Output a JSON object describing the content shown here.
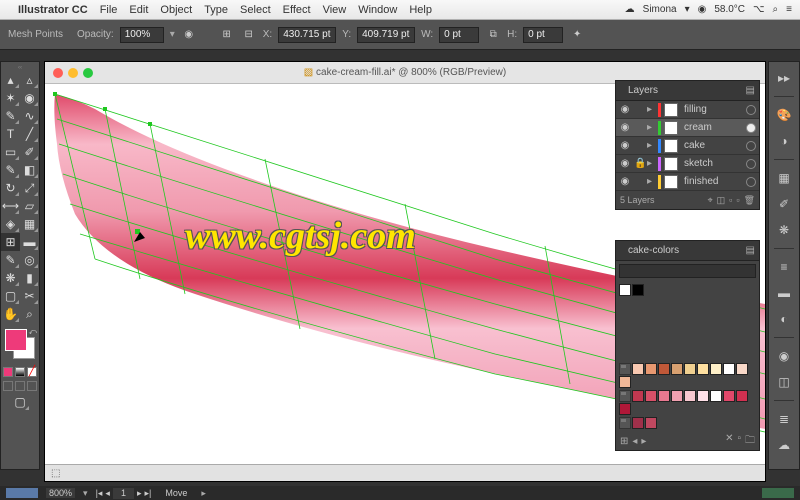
{
  "menubar": {
    "app": "Illustrator CC",
    "items": [
      "File",
      "Edit",
      "Object",
      "Type",
      "Select",
      "Effect",
      "View",
      "Window",
      "Help"
    ],
    "user": "Simona",
    "temp": "58.0°C",
    "search_icon": "⌕"
  },
  "control": {
    "label": "Mesh Points",
    "opacity_label": "Opacity:",
    "opacity_value": "100%",
    "x_label": "X:",
    "x_value": "430.715 pt",
    "y_label": "Y:",
    "y_value": "409.719 pt",
    "w_label": "W:",
    "w_value": "0 pt",
    "h_label": "H:",
    "h_value": "0 pt"
  },
  "document": {
    "title": "cake-cream-fill.ai* @ 800% (RGB/Preview)",
    "zoom": "800%",
    "mode": "Move"
  },
  "watermark": "www.cgtsj.com",
  "layers": {
    "tab": "Layers",
    "items": [
      {
        "name": "filling",
        "color": "#ff3333",
        "locked": false,
        "selected": false
      },
      {
        "name": "cream",
        "color": "#33cc33",
        "locked": false,
        "selected": true
      },
      {
        "name": "cake",
        "color": "#3388ff",
        "locked": false,
        "selected": false
      },
      {
        "name": "sketch",
        "color": "#cc66ff",
        "locked": true,
        "selected": false
      },
      {
        "name": "finished",
        "color": "#ffcc33",
        "locked": false,
        "selected": false
      }
    ],
    "count": "5 Layers"
  },
  "swatches": {
    "tab": "cake-colors",
    "search_placeholder": "",
    "colors_row1": [
      "#ffffff",
      "#000000"
    ],
    "colors_row2": [
      "#f8c8b0",
      "#e89870",
      "#c05838",
      "#d8a070",
      "#f0d090",
      "#ffe0a0",
      "#fff0c8",
      "#ffffff",
      "#f8d8c8",
      "#f0b898"
    ],
    "colors_row3": [
      "#c03850",
      "#d85068",
      "#e87890",
      "#f0a0b0",
      "#f8c8d0",
      "#ffe0e8",
      "#ffffff",
      "#e0486a",
      "#d03050",
      "#b01838"
    ],
    "colors_row4": [
      "#a0304a",
      "#c04860"
    ]
  },
  "colors": {
    "foreground": "#ee3a7a",
    "background": "#ffffff"
  }
}
